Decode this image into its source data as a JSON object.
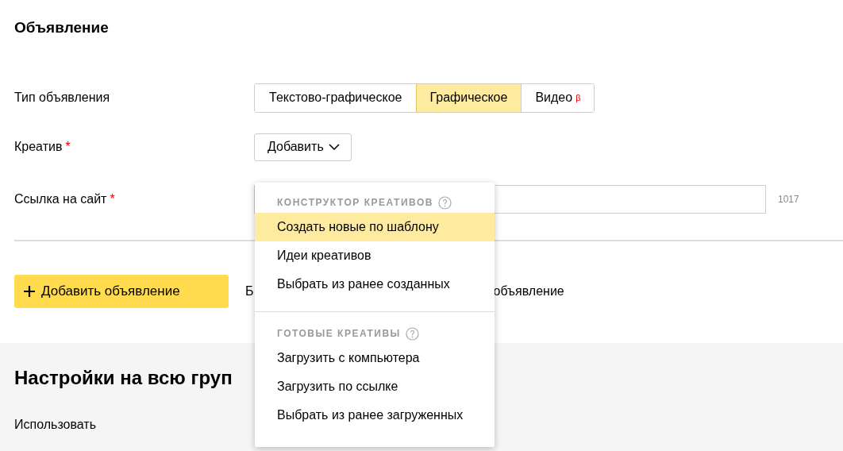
{
  "title": "Объявление",
  "fields": [
    {
      "kind": "segments",
      "label": "Тип объявления",
      "segments": [
        {
          "label": "Текстово-графическое",
          "selected": false
        },
        {
          "label": "Графическое",
          "selected": true
        },
        {
          "label": "Видео",
          "badge": "β",
          "selected": false
        }
      ]
    },
    {
      "kind": "dropdown",
      "label": "Креатив",
      "required_mark": "*",
      "button": "Добавить",
      "expanded": true
    },
    {
      "kind": "input",
      "label": "Ссылка на сайт",
      "required_mark": "*",
      "counter": "1017"
    }
  ],
  "add_button": {
    "label": "Добавить объявление"
  },
  "add_hint": {
    "before_menu": "Б",
    "after_menu": "объявление"
  },
  "group_settings": {
    "title": "Настройки на всю груп",
    "use_label": "Использовать"
  },
  "menu": {
    "sections": [
      {
        "title": "КОНСТРУКТОР КРЕАТИВОВ",
        "items": [
          {
            "label": "Создать новые по шаблону",
            "selected": true
          },
          {
            "label": "Идеи креативов",
            "selected": false
          },
          {
            "label": "Выбрать из ранее созданных",
            "selected": false
          }
        ]
      },
      {
        "title": "ГОТОВЫЕ КРЕАТИВЫ",
        "items": [
          {
            "label": "Загрузить с компьютера",
            "selected": false
          },
          {
            "label": "Загрузить по ссылке",
            "selected": false
          },
          {
            "label": "Выбрать из ранее загруженных",
            "selected": false
          }
        ]
      }
    ]
  }
}
